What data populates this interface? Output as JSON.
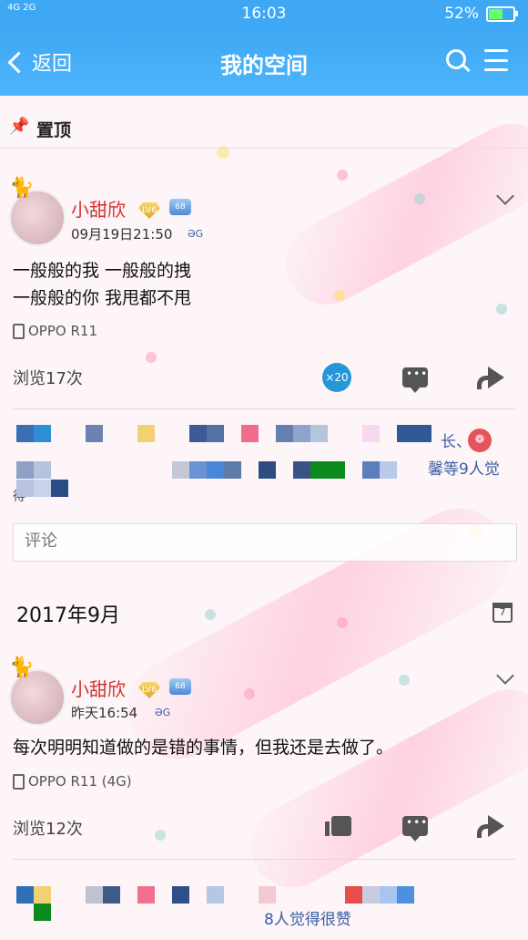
{
  "status": {
    "network": "4G 2G",
    "time": "16:03",
    "battery": "52%",
    "battery_level": 0.52
  },
  "titlebar": {
    "back_label": "返回",
    "title": "我的空间"
  },
  "pinned": {
    "label": "置顶"
  },
  "post1": {
    "username": "小甜欣",
    "badge_level": "LV6",
    "badge_vip": "68",
    "time": "09月19日21:50",
    "time_tag": "ƏG",
    "content_line1": "一般般的我 一般般的拽",
    "content_line2": "一般般的你 我甩都不甩",
    "device": "OPPO R11",
    "views": "浏览17次",
    "share_count": "×20",
    "likes_text": "馨等9人觉",
    "likes_fragment": "长、",
    "likes_tail": "得"
  },
  "comment_box": {
    "placeholder": "评论"
  },
  "month_header": {
    "label": "2017年9月",
    "calendar_day": "7"
  },
  "post2": {
    "username": "小甜欣",
    "badge_level": "LV6",
    "badge_vip": "68",
    "time": "昨天16:54",
    "time_tag": "ƏG",
    "content": "每次明明知道做的是错的事情，但我还是去做了。",
    "device": "OPPO R11 (4G)",
    "views": "浏览12次",
    "likes_text": "8人觉得很赞"
  },
  "colors": {
    "header_blue": "#3fa8f4",
    "username_red": "#d6302f",
    "link_blue": "#3b5ea5"
  }
}
